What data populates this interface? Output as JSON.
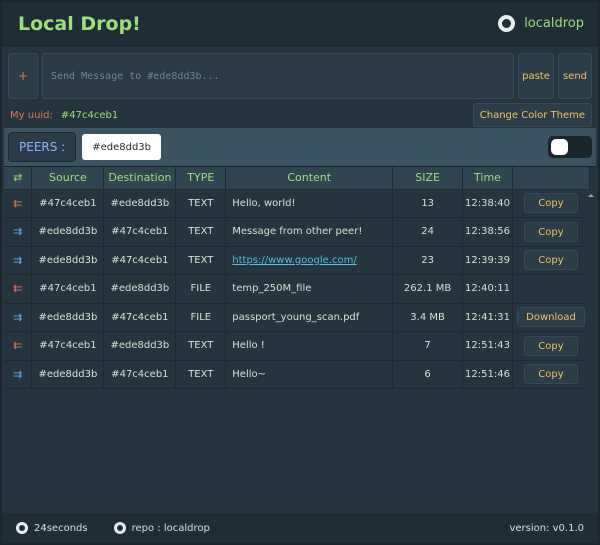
{
  "header": {
    "title": "Local Drop!",
    "repo_label": "localdrop",
    "icon": "github-icon"
  },
  "compose": {
    "add_label": "+",
    "placeholder": "Send Message to #ede8dd3b...",
    "paste_label": "paste",
    "send_label": "send"
  },
  "identity": {
    "label": "My uuid:",
    "value": "#47c4ceb1",
    "theme_button": "Change Color Theme"
  },
  "peers": {
    "label": "PEERS :",
    "selected": "#ede8dd3b"
  },
  "table": {
    "headers": {
      "direction": "⇄",
      "source": "Source",
      "destination": "Destination",
      "type": "TYPE",
      "content": "Content",
      "size": "SIZE",
      "time": "Time"
    },
    "rows": [
      {
        "dir": "⇇",
        "source": "#47c4ceb1",
        "destination": "#ede8dd3b",
        "type": "TEXT",
        "content": "Hello, world!",
        "size": "13",
        "time": "12:38:40",
        "action": "Copy"
      },
      {
        "dir": "⇉",
        "source": "#ede8dd3b",
        "destination": "#47c4ceb1",
        "type": "TEXT",
        "content": "Message from other peer!",
        "size": "24",
        "time": "12:38:56",
        "action": "Copy"
      },
      {
        "dir": "⇉",
        "source": "#ede8dd3b",
        "destination": "#47c4ceb1",
        "type": "TEXT",
        "content": "https://www.google.com/",
        "size": "23",
        "time": "12:39:39",
        "action": "Copy"
      },
      {
        "dir": "⇇",
        "source": "#47c4ceb1",
        "destination": "#ede8dd3b",
        "type": "FILE",
        "content": "temp_250M_file",
        "size": "262.1 MB",
        "time": "12:40:11",
        "action": ""
      },
      {
        "dir": "⇉",
        "source": "#ede8dd3b",
        "destination": "#47c4ceb1",
        "type": "FILE",
        "content": "passport_young_scan.pdf",
        "size": "3.4 MB",
        "time": "12:41:31",
        "action": "Download"
      },
      {
        "dir": "⇇",
        "source": "#47c4ceb1",
        "destination": "#ede8dd3b",
        "type": "TEXT",
        "content": "Hello !",
        "size": "7",
        "time": "12:51:43",
        "action": "Copy"
      },
      {
        "dir": "⇉",
        "source": "#ede8dd3b",
        "destination": "#47c4ceb1",
        "type": "TEXT",
        "content": "Hello~",
        "size": "6",
        "time": "12:51:46",
        "action": "Copy"
      }
    ]
  },
  "footer": {
    "author": "24seconds",
    "repo": "repo : localdrop",
    "version": "version: v0.1.0"
  },
  "colors": {
    "accent": "#9be07a",
    "button_text": "#f0c264",
    "incoming": "#e8735a",
    "outgoing": "#5fb4e8",
    "link": "#4fc3d9"
  }
}
